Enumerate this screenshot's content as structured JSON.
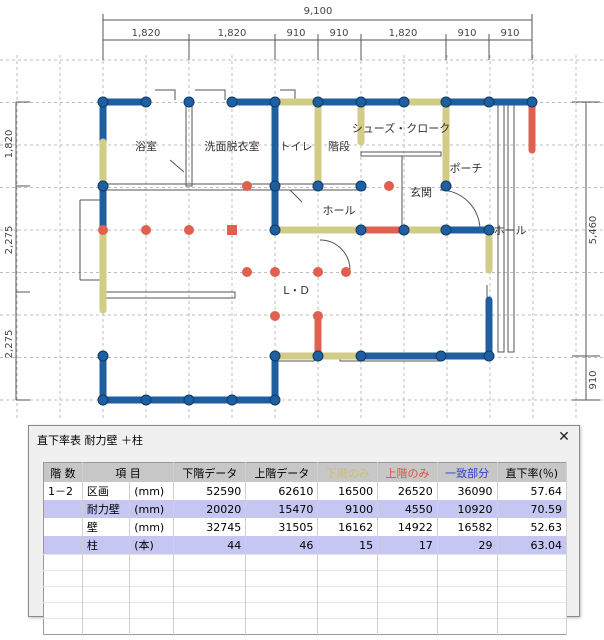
{
  "plan": {
    "overall_dim": "9,100",
    "top_dims": [
      "1,820",
      "1,820",
      "910",
      "910",
      "1,820",
      "910",
      "910"
    ],
    "left_dims": [
      "1,820",
      "2,275",
      "2,275"
    ],
    "right_dims": [
      "5,460",
      "910"
    ],
    "rooms": {
      "bath": "浴室",
      "dressing": "洗面脱衣室",
      "toilet": "トイレ",
      "stairs": "階段",
      "shoes": "シューズ・クローク",
      "porch": "ポーチ",
      "entrance": "玄関",
      "hall": "ホール",
      "ld": "L・D",
      "side_note": "ホール"
    }
  },
  "dialog": {
    "title": "直下率表  耐力壁 ＋柱",
    "close": "✕",
    "headers": [
      "階 数",
      "項  目",
      "下階データ",
      "上階データ",
      "下階のみ",
      "上階のみ",
      "一致部分",
      "直下率(％)"
    ],
    "header_colors": {
      "lower_only": "#c8c070",
      "upper_only": "#e05040",
      "match": "#3040c0"
    },
    "rows": [
      {
        "floor": "1－2",
        "item": "区画",
        "unit": "(mm)",
        "lower": "52590",
        "upper": "62610",
        "lower_only": "16500",
        "upper_only": "26520",
        "match": "36090",
        "rate": "57.64"
      },
      {
        "floor": "",
        "item": "耐力壁",
        "unit": "(mm)",
        "lower": "20020",
        "upper": "15470",
        "lower_only": "9100",
        "upper_only": "4550",
        "match": "10920",
        "rate": "70.59"
      },
      {
        "floor": "",
        "item": "壁",
        "unit": "(mm)",
        "lower": "32745",
        "upper": "31505",
        "lower_only": "16162",
        "upper_only": "14922",
        "match": "16582",
        "rate": "52.63"
      },
      {
        "floor": "",
        "item": "柱",
        "unit": "(本)",
        "lower": "44",
        "upper": "46",
        "lower_only": "15",
        "upper_only": "17",
        "match": "29",
        "rate": "63.04"
      }
    ]
  },
  "colors": {
    "match_wall": "#1f5fa0",
    "lower_only_wall": "#d2cc86",
    "upper_only_wall": "#e06050",
    "grid": "#b8b8b8"
  }
}
